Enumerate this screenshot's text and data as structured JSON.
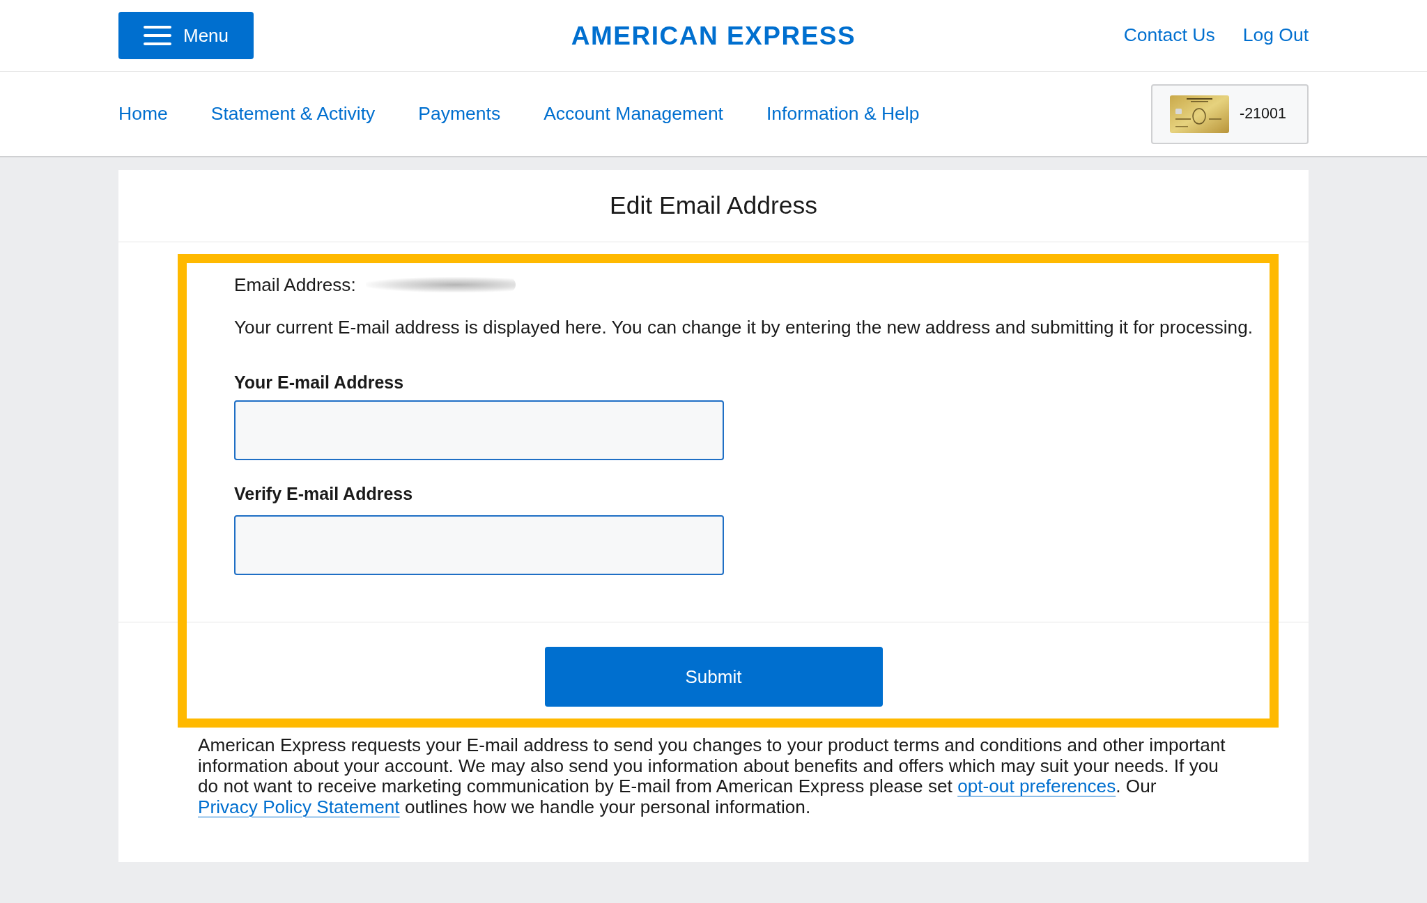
{
  "header": {
    "menu_button": "Menu",
    "logo": "AMERICAN EXPRESS",
    "links": [
      "Contact Us",
      "Log Out"
    ]
  },
  "nav": {
    "items": [
      "Home",
      "Statement & Activity",
      "Payments",
      "Account Management",
      "Information & Help"
    ],
    "card_number": "-21001"
  },
  "page": {
    "title": "Edit Email Address"
  },
  "form": {
    "current_label": "Email Address:",
    "current_value_redacted": true,
    "description": "Your current E-mail address is displayed here. You can change it by entering the new address and submitting it for processing.",
    "fields": [
      {
        "label": "Your E-mail Address"
      },
      {
        "label": "Verify E-mail Address"
      }
    ],
    "submit": "Submit"
  },
  "highlight_frame": true,
  "disclaimer": [
    {
      "kind": "text",
      "text": "American Express requests your E-mail address to send you changes to your product terms and conditions and other important information about your account. We may also send you information about benefits and offers which may suit your needs. If you do not want to receive marketing communication by E-mail from American Express please set "
    },
    {
      "kind": "link",
      "text": "opt-out preferences"
    },
    {
      "kind": "text",
      "text": ". Our "
    },
    {
      "kind": "link",
      "text": "Privacy Policy Statement"
    },
    {
      "kind": "text",
      "text": " outlines how we handle your personal information."
    }
  ]
}
